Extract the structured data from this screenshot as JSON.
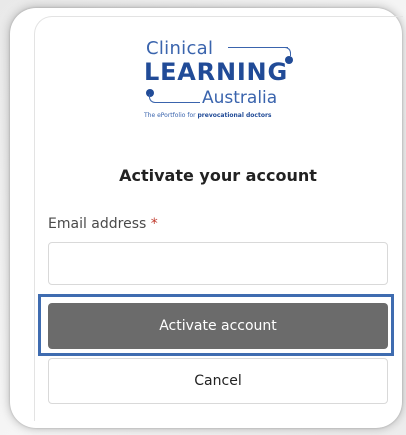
{
  "logo": {
    "line1": "Clinical",
    "line2": "LEARNING",
    "line3": "Australia",
    "tagline_prefix": "The ePortfolio for ",
    "tagline_bold": "prevocational doctors",
    "color_primary": "#214b97",
    "color_secondary": "#3a64ad"
  },
  "form": {
    "title": "Activate your account",
    "email_label": "Email address",
    "required_marker": "*",
    "email_value": "",
    "email_placeholder": "",
    "submit_label": "Activate account",
    "cancel_label": "Cancel"
  },
  "colors": {
    "submit_bg": "#6b6b6b",
    "highlight_border": "#3f6cb0",
    "required": "#c0392b"
  }
}
